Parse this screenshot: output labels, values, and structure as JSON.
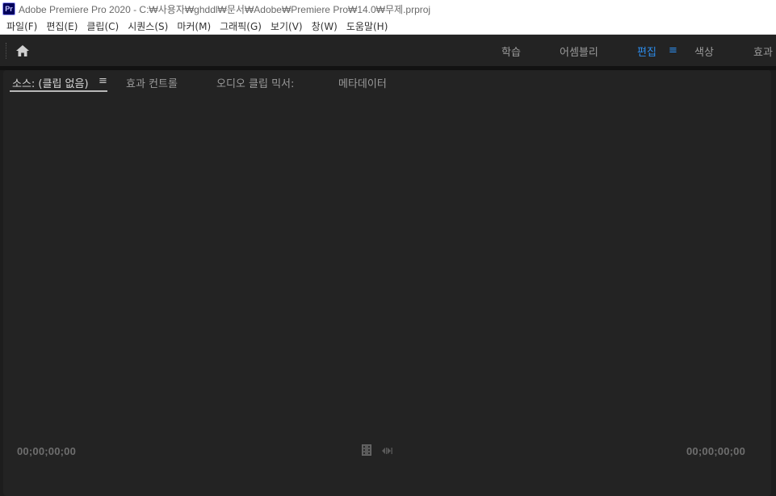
{
  "window": {
    "app_icon": "Pr",
    "title": "Adobe Premiere Pro 2020 - C:₩사용자₩ghddl₩문서₩Adobe₩Premiere Pro₩14.0₩무제.prproj"
  },
  "menu": [
    "파일(F)",
    "편집(E)",
    "클립(C)",
    "시퀀스(S)",
    "마커(M)",
    "그래픽(G)",
    "보기(V)",
    "창(W)",
    "도움말(H)"
  ],
  "workspace": {
    "tabs": [
      "학습",
      "어셈블리",
      "편집",
      "색상",
      "효과"
    ],
    "active": "편집",
    "menu_glyph": "≡"
  },
  "panel": {
    "tabs": [
      "소스: (클립 없음)",
      "효과 컨트롤",
      "오디오 클립 믹서:",
      "메타데이터"
    ],
    "active_tab_menu_glyph": "≡",
    "timecode_in": "00;00;00;00",
    "timecode_out": "00;00;00;00"
  },
  "icons": [
    "home-icon",
    "film-icon",
    "export-frame-icon"
  ]
}
